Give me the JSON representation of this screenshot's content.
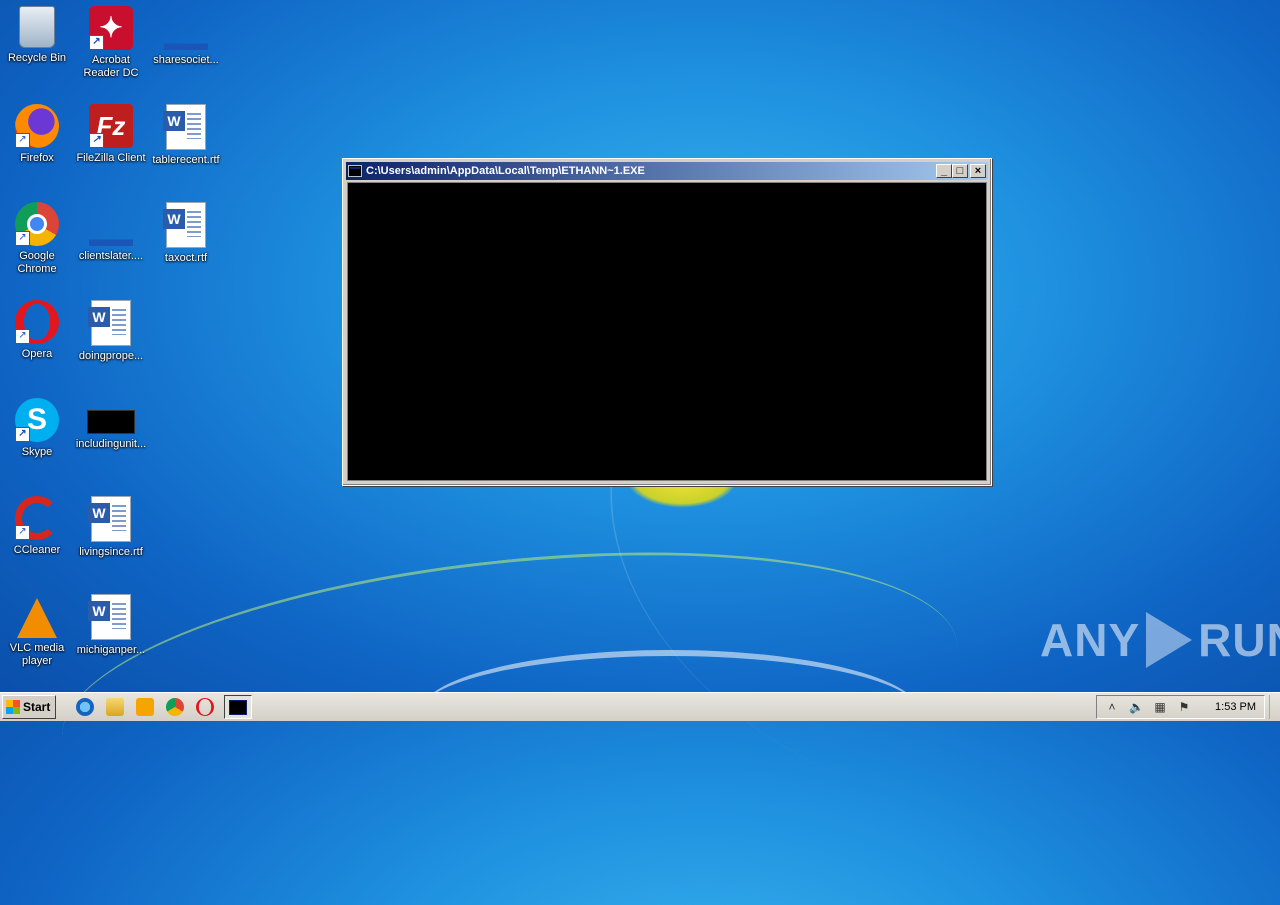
{
  "desktop": {
    "icons": [
      {
        "label": "Recycle Bin",
        "icon": "recycle-bin-icon"
      },
      {
        "label": "Acrobat Reader DC",
        "icon": "acrobat-icon"
      },
      {
        "label": "sharesociet...",
        "icon": "blank-file-icon"
      },
      {
        "label": "Firefox",
        "icon": "firefox-icon"
      },
      {
        "label": "FileZilla Client",
        "icon": "filezilla-icon"
      },
      {
        "label": "tablerecent.rtf",
        "icon": "word-doc-icon"
      },
      {
        "label": "Google Chrome",
        "icon": "chrome-icon"
      },
      {
        "label": "clientslater....",
        "icon": "blank-file-icon"
      },
      {
        "label": "taxoct.rtf",
        "icon": "word-doc-icon"
      },
      {
        "label": "Opera",
        "icon": "opera-icon"
      },
      {
        "label": "doingprope...",
        "icon": "word-doc-icon"
      },
      {
        "label": "Skype",
        "icon": "skype-icon"
      },
      {
        "label": "includingunit...",
        "icon": "black-file-icon"
      },
      {
        "label": "CCleaner",
        "icon": "ccleaner-icon"
      },
      {
        "label": "livingsince.rtf",
        "icon": "word-doc-icon"
      },
      {
        "label": "VLC media player",
        "icon": "vlc-icon"
      },
      {
        "label": "michiganper...",
        "icon": "word-doc-icon"
      }
    ]
  },
  "window": {
    "title": "C:\\Users\\admin\\AppData\\Local\\Temp\\ETHANN~1.EXE",
    "minimize": "_",
    "maximize": "□",
    "close": "×"
  },
  "watermark": {
    "left": "ANY",
    "right": "RUN"
  },
  "taskbar": {
    "start_label": "Start",
    "quick_launch": [
      "internet-explorer-icon",
      "explorer-icon",
      "media-player-icon",
      "chrome-icon",
      "opera-icon"
    ],
    "clock": "1:53 PM"
  }
}
